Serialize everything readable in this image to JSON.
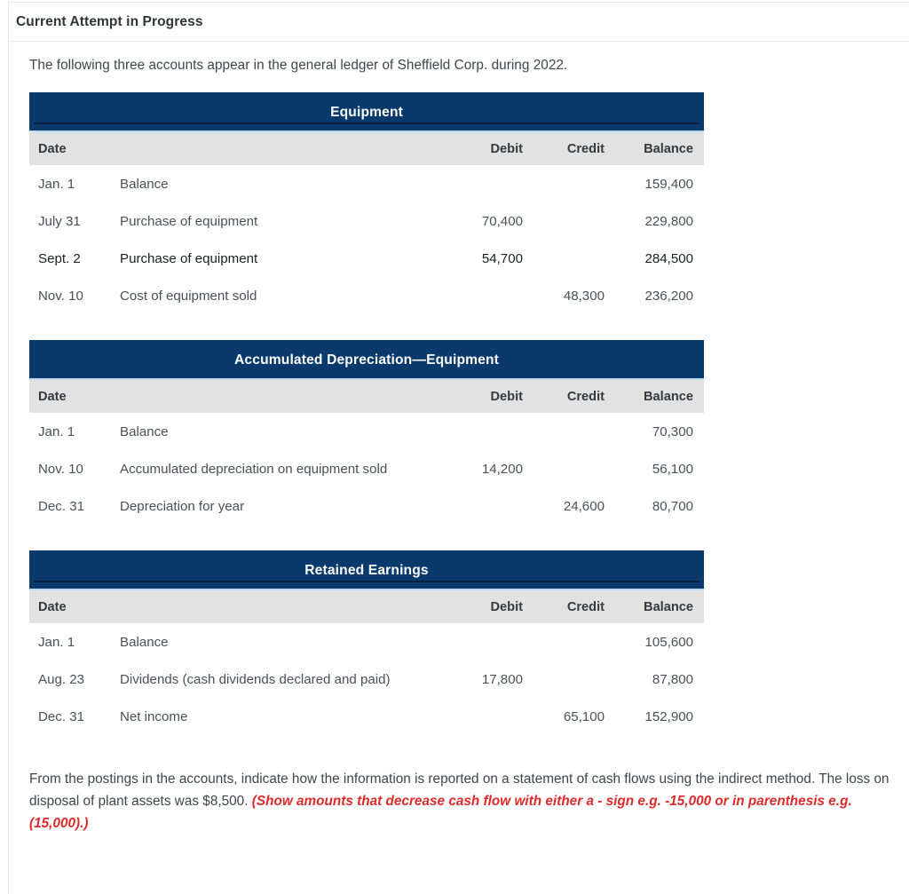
{
  "panel": {
    "header_title": "Current Attempt in Progress"
  },
  "intro": "The following three accounts appear in the general ledger of Sheffield Corp. during 2022.",
  "columns": {
    "date": "Date",
    "description": "",
    "debit": "Debit",
    "credit": "Credit",
    "balance": "Balance"
  },
  "tables": [
    {
      "account_title": "Equipment",
      "has_title_rule": true,
      "rows": [
        {
          "date": "Jan. 1",
          "description": "Balance",
          "debit": "",
          "credit": "",
          "balance": "159,400",
          "emphasis": false
        },
        {
          "date": "July 31",
          "description": "Purchase of equipment",
          "debit": "70,400",
          "credit": "",
          "balance": "229,800",
          "emphasis": false
        },
        {
          "date": "Sept. 2",
          "description": "Purchase of equipment",
          "debit": "54,700",
          "credit": "",
          "balance": "284,500",
          "emphasis": true
        },
        {
          "date": "Nov. 10",
          "description": "Cost of equipment sold",
          "debit": "",
          "credit": "48,300",
          "balance": "236,200",
          "emphasis": false
        }
      ]
    },
    {
      "account_title": "Accumulated Depreciation—Equipment",
      "has_title_rule": false,
      "rows": [
        {
          "date": "Jan. 1",
          "description": "Balance",
          "debit": "",
          "credit": "",
          "balance": "70,300",
          "emphasis": false
        },
        {
          "date": "Nov. 10",
          "description": "Accumulated depreciation on equipment sold",
          "debit": "14,200",
          "credit": "",
          "balance": "56,100",
          "emphasis": false
        },
        {
          "date": "Dec. 31",
          "description": "Depreciation for year",
          "debit": "",
          "credit": "24,600",
          "balance": "80,700",
          "emphasis": false
        }
      ]
    },
    {
      "account_title": "Retained Earnings",
      "has_title_rule": true,
      "rows": [
        {
          "date": "Jan. 1",
          "description": "Balance",
          "debit": "",
          "credit": "",
          "balance": "105,600",
          "emphasis": false
        },
        {
          "date": "Aug. 23",
          "description": "Dividends (cash dividends declared and paid)",
          "debit": "17,800",
          "credit": "",
          "balance": "87,800",
          "emphasis": false
        },
        {
          "date": "Dec. 31",
          "description": "Net income",
          "debit": "",
          "credit": "65,100",
          "balance": "152,900",
          "emphasis": false
        }
      ]
    }
  ],
  "closing": {
    "text": "From the postings in the accounts, indicate how the information is reported on a statement of cash flows using the indirect method. The loss on disposal of plant assets was $8,500. ",
    "note": "(Show amounts that decrease cash flow with either a - sign e.g. -15,000 or in parenthesis e.g. (15,000).)"
  },
  "colors": {
    "account_header_bg": "#0a3a6b",
    "account_header_rule": "#081f3c",
    "column_header_bg": "#e2e2e2",
    "column_header_top_accent": "#bcdcf2",
    "note_red": "#dd2b2b",
    "body_text": "#4a5057"
  }
}
